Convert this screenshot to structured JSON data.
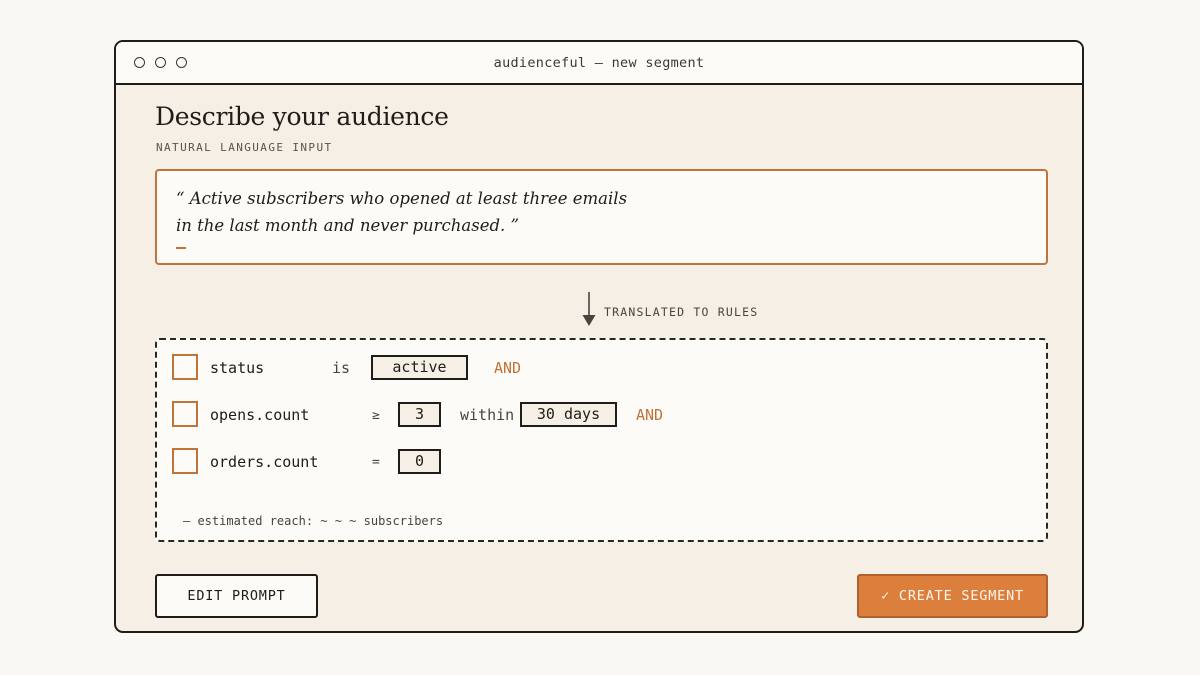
{
  "window": {
    "title": "audienceful — new segment"
  },
  "main": {
    "heading": "Describe your audience",
    "subheading": "NATURAL LANGUAGE INPUT",
    "prompt": {
      "line1": "“ Active subscribers who opened at least three emails",
      "line2": "in the last month and never purchased. ”"
    },
    "translate_label": "TRANSLATED TO RULES"
  },
  "rules": [
    {
      "field": "status",
      "operator": "is",
      "value": "active",
      "connector": "AND"
    },
    {
      "field": "opens.count",
      "operator": "≥",
      "value": "3",
      "qualifier": "within",
      "qualifier_value": "30 days",
      "connector": "AND"
    },
    {
      "field": "orders.count",
      "operator": "=",
      "value": "0"
    }
  ],
  "reach_text": "— estimated reach: ~ ~ ~ subscribers",
  "actions": {
    "edit_label": "EDIT PROMPT",
    "create_label": "✓ CREATE SEGMENT"
  },
  "colors": {
    "accent": "#dd7f3c",
    "accent_border": "#c0743a",
    "background": "#f5efe5",
    "ink": "#1f1c19"
  }
}
